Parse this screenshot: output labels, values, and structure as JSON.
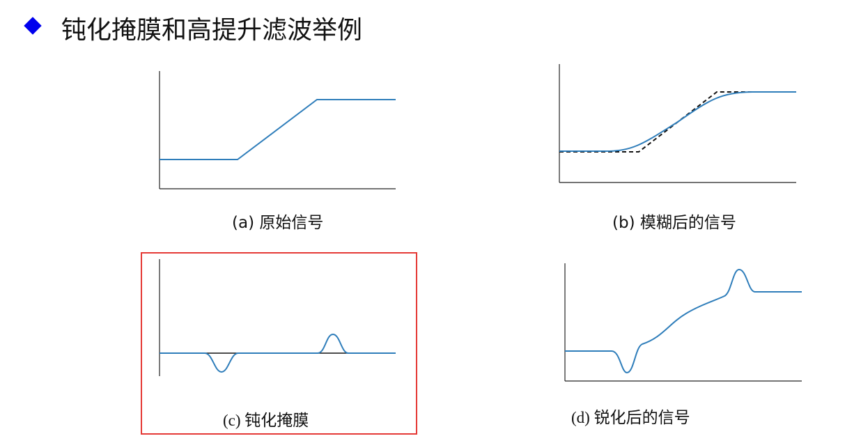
{
  "title": "钝化掩膜和高提升滤波举例",
  "captions": {
    "a": "(a) 原始信号",
    "b": "(b) 模糊后的信号",
    "c": "(c) 钝化掩膜",
    "d": "(d) 锐化后的信号"
  },
  "colors": {
    "curve": "#2e7dba",
    "highlight": "#e53935",
    "bullet": "#0000ee"
  }
}
